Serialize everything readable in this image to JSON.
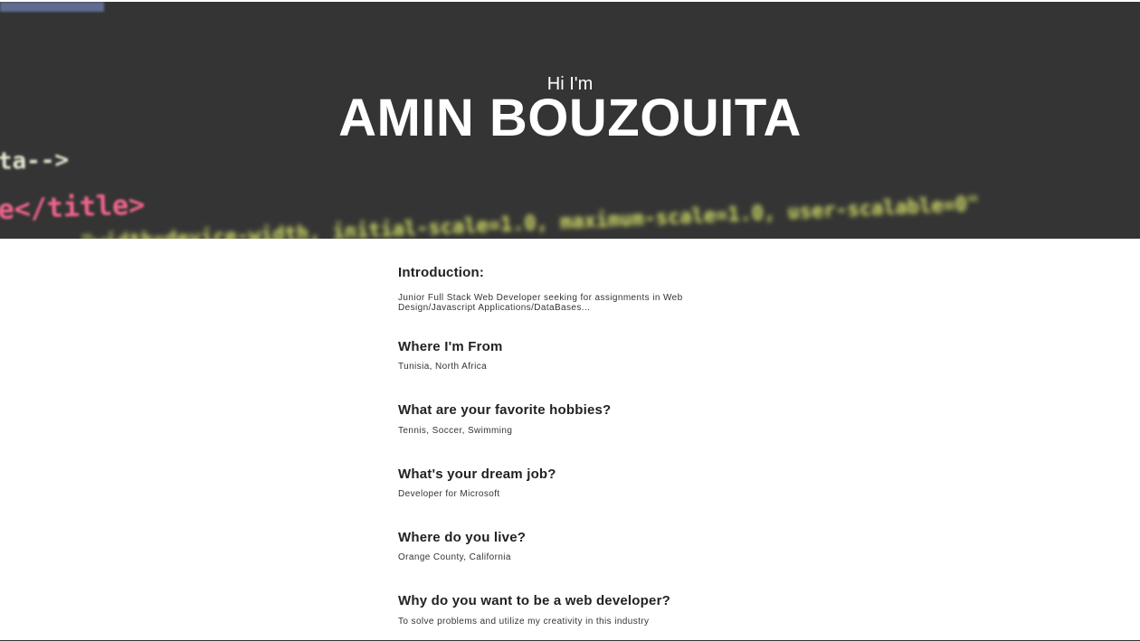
{
  "hero": {
    "greeting": "Hi I'm",
    "name": "AMIN BOUZOUITA",
    "background_code": {
      "line1": "ta-->",
      "line2": "e</title>",
      "line3": "\"width=device-width, initial-scale=1.0, maximum-scale=1.0, user-scalable=0\"",
      "colors": {
        "bg": "#343434",
        "comment": "#e8ecd9",
        "tag": "#f0658c",
        "string": "#d6e066",
        "accent": "#7a8cc4"
      }
    }
  },
  "sections": [
    {
      "heading": "Introduction:",
      "body": "Junior Full Stack Web Developer seeking for assignments in Web Design/Javascript Applications/DataBases..."
    },
    {
      "heading": "Where I'm From",
      "body": "Tunisia, North Africa"
    },
    {
      "heading": "What are your favorite hobbies?",
      "body": "Tennis, Soccer, Swimming"
    },
    {
      "heading": "What's your dream job?",
      "body": "Developer for Microsoft"
    },
    {
      "heading": "Where do you live?",
      "body": "Orange County, California"
    },
    {
      "heading": "Why do you want to be a web developer?",
      "body": "To solve problems and utilize my creativity in this industry"
    }
  ]
}
